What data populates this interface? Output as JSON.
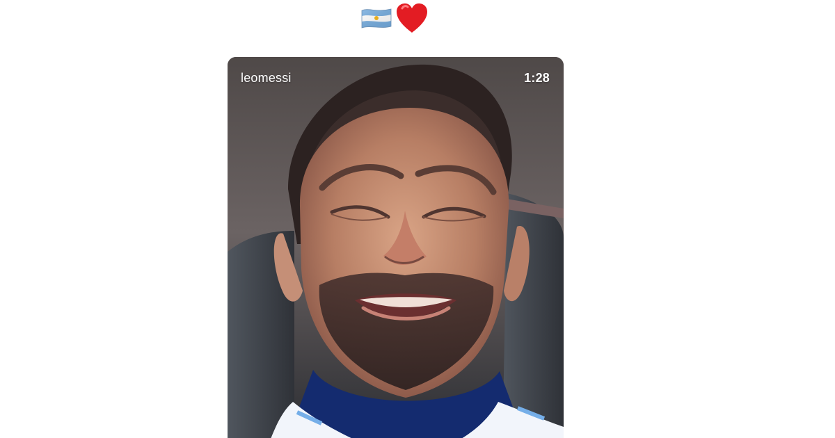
{
  "post": {
    "caption_emojis": [
      "argentina-flag-icon",
      "red-heart-icon"
    ]
  },
  "video": {
    "username": "leomessi",
    "duration": "1:28"
  }
}
